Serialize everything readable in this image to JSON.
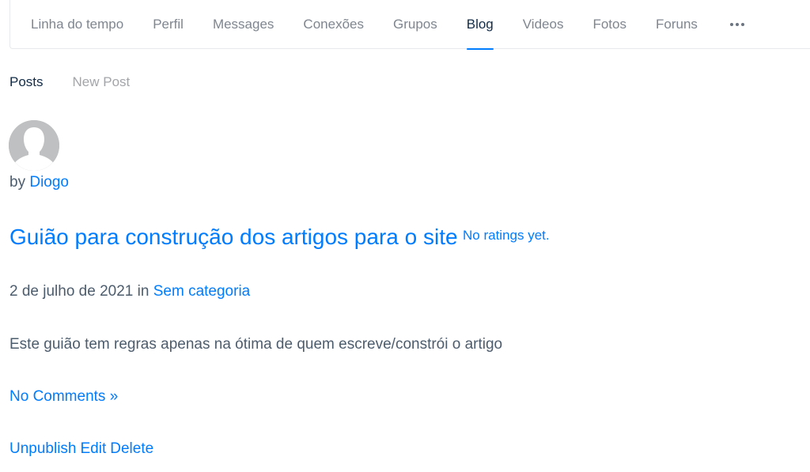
{
  "topnav": {
    "items": [
      {
        "label": "Linha do tempo"
      },
      {
        "label": "Perfil"
      },
      {
        "label": "Messages"
      },
      {
        "label": "Conexões"
      },
      {
        "label": "Grupos"
      },
      {
        "label": "Blog"
      },
      {
        "label": "Videos"
      },
      {
        "label": "Fotos"
      },
      {
        "label": "Foruns"
      }
    ],
    "active": "Blog",
    "more_icon": "ellipsis-icon"
  },
  "subnav": {
    "items": [
      {
        "label": "Posts"
      },
      {
        "label": "New Post"
      }
    ],
    "active": "Posts"
  },
  "post": {
    "avatar_icon": "default-avatar-icon",
    "by_prefix": "by",
    "author": "Diogo",
    "title": "Guião para construção dos artigos para o site",
    "rating": "No ratings yet.",
    "date": "2 de julho de 2021",
    "in_word": "in",
    "category": "Sem categoria",
    "excerpt": "Este guião tem regras apenas na ótima de quem escreve/constrói o artigo",
    "comments_link": "No Comments »",
    "actions": {
      "unpublish": "Unpublish",
      "edit": "Edit",
      "delete": "Delete"
    }
  },
  "colors": {
    "link": "#007cff",
    "text": "#4d5c6d",
    "nav_text": "#7f868f",
    "nav_active": "#122b46"
  }
}
